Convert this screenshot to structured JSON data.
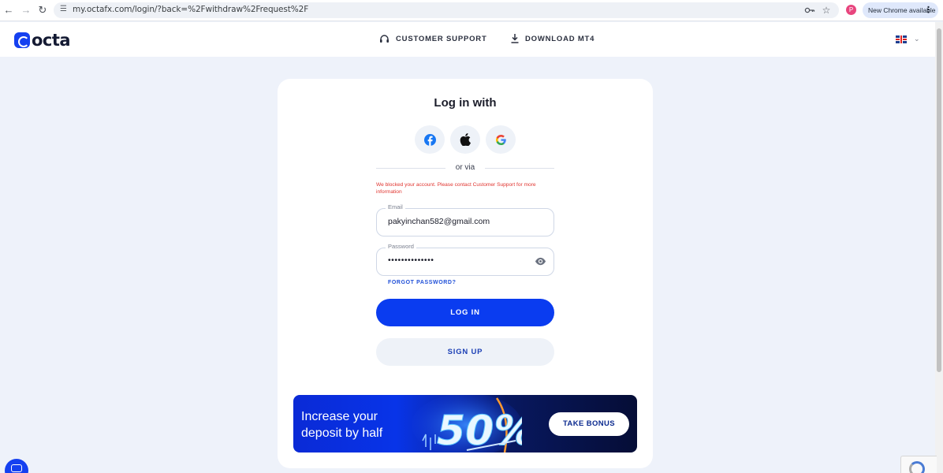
{
  "browser": {
    "url": "my.octafx.com/login/?back=%2Fwithdraw%2Frequest%2F",
    "profile_initial": "P",
    "update_label": "New Chrome available"
  },
  "header": {
    "logo_text": "octa",
    "support_label": "CUSTOMER SUPPORT",
    "download_label": "DOWNLOAD MT4",
    "language": "en-GB"
  },
  "login": {
    "title": "Log in with",
    "social": [
      "facebook",
      "apple",
      "google"
    ],
    "divider_text": "or via",
    "error_message": "We blocked your account. Please contact Customer Support for more information",
    "email": {
      "label": "Email",
      "value": "pakyinchan582@gmail.com"
    },
    "password": {
      "label": "Password",
      "value": "••••••••••••••"
    },
    "forgot_label": "FORGOT PASSWORD?",
    "login_label": "LOG IN",
    "signup_label": "SIGN UP"
  },
  "banner": {
    "line1": "Increase your",
    "line2": "deposit by half",
    "promo_value": "50%",
    "button_label": "TAKE BONUS"
  },
  "colors": {
    "primary": "#0a3cf0",
    "error": "#e0342f",
    "page_bg": "#eef2fa"
  }
}
